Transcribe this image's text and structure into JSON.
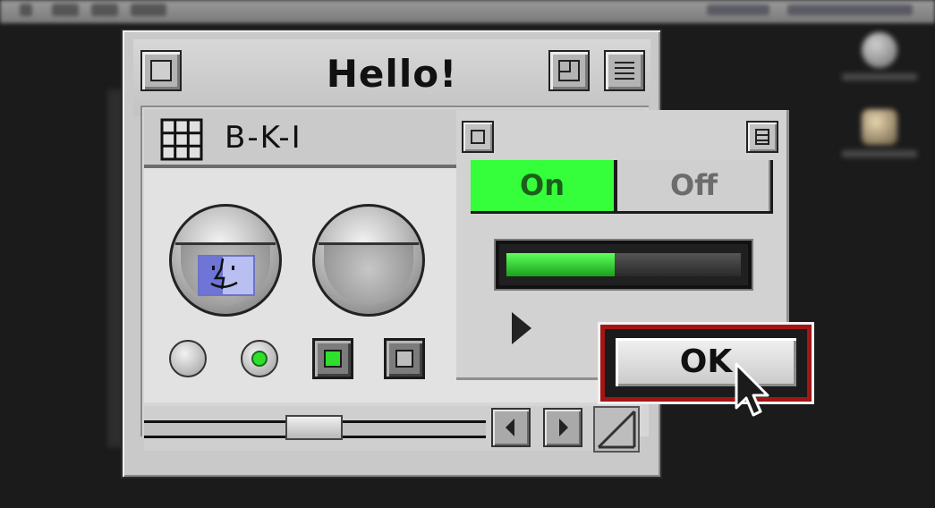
{
  "window": {
    "title": "Hello!"
  },
  "panel": {
    "title": "B-K-I"
  },
  "toggle": {
    "on_label": "On",
    "off_label": "Off",
    "selected": "On"
  },
  "progress": {
    "value": 0.46
  },
  "dialog": {
    "ok_label": "OK"
  },
  "colors": {
    "accent_green": "#34ff3a",
    "focus_red": "#a31616",
    "chrome_gray": "#c9c9c9"
  },
  "icons": [
    "grid-icon",
    "finder-icon",
    "close-box-icon",
    "zoom-box-icon",
    "collapse-box-icon",
    "disclosure-triangle-icon",
    "arrow-left-icon",
    "arrow-right-icon",
    "grow-box-icon",
    "pointer-cursor-icon"
  ]
}
